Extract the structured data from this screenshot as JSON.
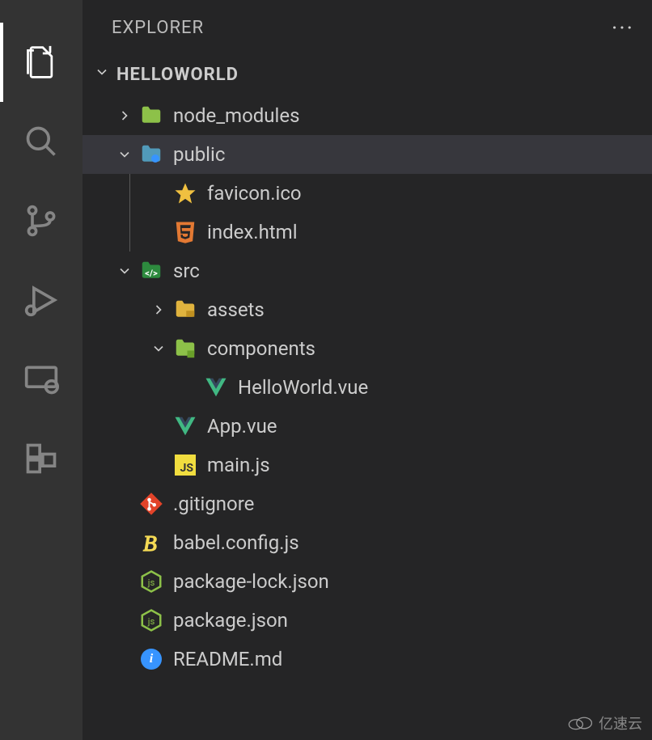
{
  "sidebar": {
    "title": "EXPLORER",
    "project": "HELLOWORLD"
  },
  "tree": {
    "node_modules": "node_modules",
    "public": "public",
    "favicon": "favicon.ico",
    "index_html": "index.html",
    "src": "src",
    "assets": "assets",
    "components": "components",
    "helloworld_vue": "HelloWorld.vue",
    "app_vue": "App.vue",
    "main_js": "main.js",
    "gitignore": ".gitignore",
    "babel_config": "babel.config.js",
    "package_lock": "package-lock.json",
    "package_json": "package.json",
    "readme": "README.md"
  },
  "watermark": "亿速云"
}
